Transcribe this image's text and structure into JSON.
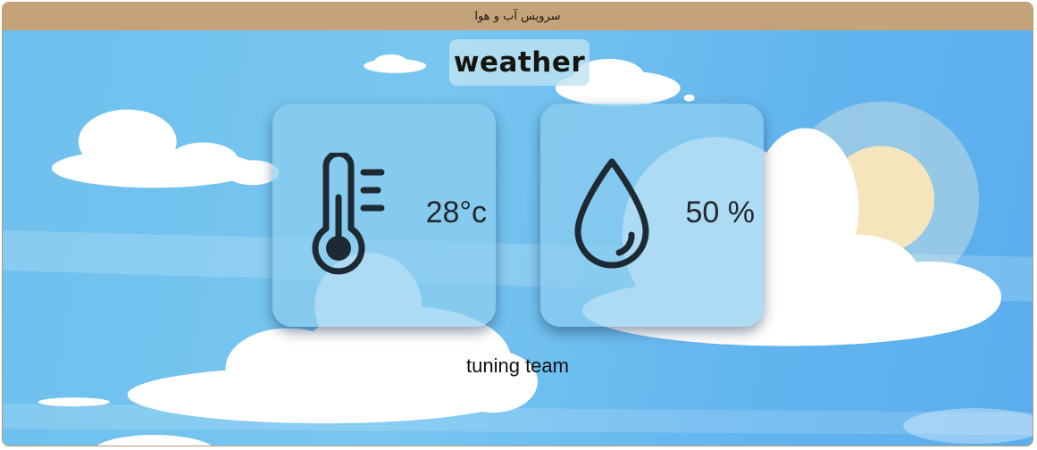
{
  "window": {
    "title": "سرویس آب و هوا"
  },
  "app": {
    "heading": "weather",
    "footer": "tuning team"
  },
  "cards": {
    "temperature": {
      "value": "28°c",
      "icon": "thermometer-icon"
    },
    "humidity": {
      "value": "50 %",
      "icon": "water-drop-icon"
    }
  },
  "colors": {
    "titlebar": "#c4a37a",
    "sky": "#6ec0ee",
    "card": "#8ccdee",
    "icon": "#1e2a33"
  }
}
